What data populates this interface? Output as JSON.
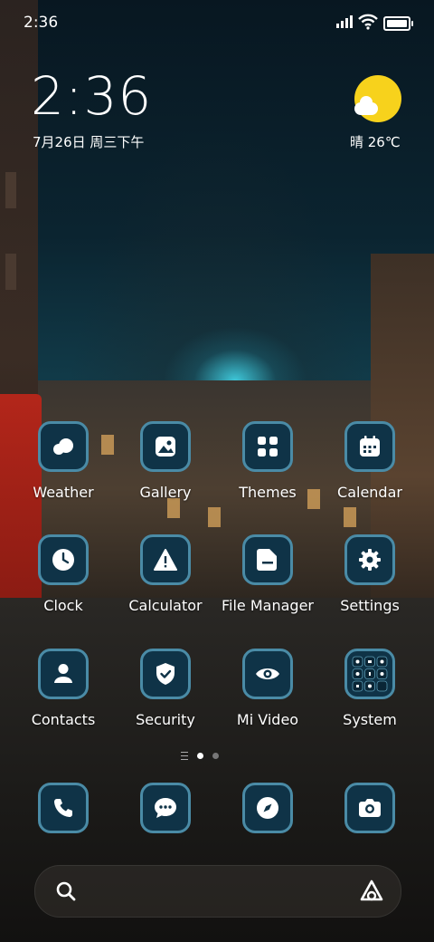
{
  "status_bar": {
    "time": "2:36"
  },
  "clock_widget": {
    "time": "2:36",
    "date": "7月26日 周三下午"
  },
  "weather_widget": {
    "text": "晴 26℃"
  },
  "apps": [
    {
      "label": "Weather",
      "icon": "weather-icon"
    },
    {
      "label": "Gallery",
      "icon": "gallery-icon"
    },
    {
      "label": "Themes",
      "icon": "themes-icon"
    },
    {
      "label": "Calendar",
      "icon": "calendar-icon"
    },
    {
      "label": "Clock",
      "icon": "clock-icon"
    },
    {
      "label": "Calculator",
      "icon": "calculator-icon"
    },
    {
      "label": "File Manager",
      "icon": "folder-icon"
    },
    {
      "label": "Settings",
      "icon": "gear-icon"
    },
    {
      "label": "Contacts",
      "icon": "contacts-icon"
    },
    {
      "label": "Security",
      "icon": "shield-icon"
    },
    {
      "label": "Mi Video",
      "icon": "eye-icon"
    },
    {
      "label": "System",
      "icon": "system-folder-icon"
    }
  ],
  "dock": [
    {
      "icon": "phone-icon"
    },
    {
      "icon": "messages-icon"
    },
    {
      "icon": "compass-icon"
    },
    {
      "icon": "camera-icon"
    }
  ],
  "page_indicator": {
    "pages": 2,
    "current": 1
  },
  "colors": {
    "icon_bg": "#0f3347",
    "icon_border": "#4a8ba6",
    "sun": "#f7d21c"
  }
}
